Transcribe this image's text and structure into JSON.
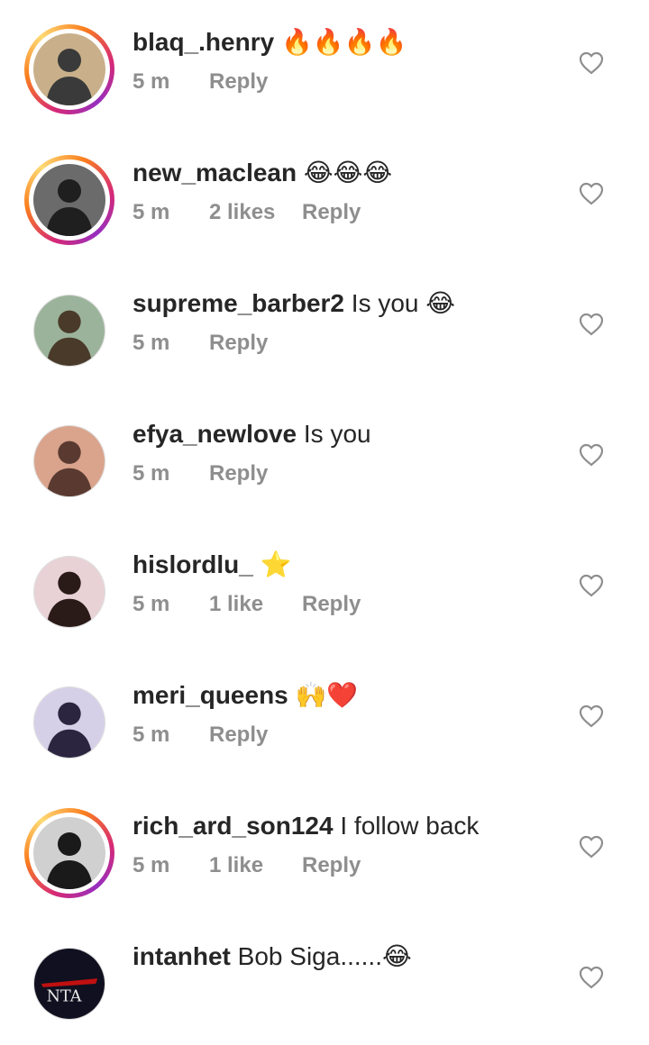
{
  "comments": [
    {
      "username": "blaq_.henry",
      "text": "🔥🔥🔥🔥",
      "time": "5 m",
      "likes": "",
      "reply_label": "Reply",
      "story_ring": true,
      "avatar_icon": "person-avatar",
      "avatar_colors": [
        "#c9b08a",
        "#3a3a3a"
      ]
    },
    {
      "username": "new_maclean",
      "text": "😂😂😂",
      "time": "5 m",
      "likes": "2 likes",
      "reply_label": "Reply",
      "story_ring": true,
      "avatar_icon": "person-avatar",
      "avatar_colors": [
        "#6b6b6b",
        "#1f1f1f"
      ]
    },
    {
      "username": "supreme_barber2",
      "text": "Is you 😂",
      "time": "5 m",
      "likes": "",
      "reply_label": "Reply",
      "story_ring": false,
      "avatar_icon": "person-avatar",
      "avatar_colors": [
        "#9bb39a",
        "#4a3a2a"
      ]
    },
    {
      "username": "efya_newlove",
      "text": "Is you",
      "time": "5 m",
      "likes": "",
      "reply_label": "Reply",
      "story_ring": false,
      "avatar_icon": "person-avatar",
      "avatar_colors": [
        "#d9a38c",
        "#5a3a30"
      ]
    },
    {
      "username": "hislordlu_",
      "text": "⭐",
      "time": "5 m",
      "likes": "1 like",
      "reply_label": "Reply",
      "story_ring": false,
      "avatar_icon": "person-avatar",
      "avatar_colors": [
        "#e8d2d6",
        "#2a1a18"
      ]
    },
    {
      "username": "meri_queens",
      "text": "🙌❤️",
      "time": "5 m",
      "likes": "",
      "reply_label": "Reply",
      "story_ring": false,
      "avatar_icon": "person-avatar",
      "avatar_colors": [
        "#d6cfe8",
        "#2b2540"
      ]
    },
    {
      "username": "rich_ard_son124",
      "text": "I follow back",
      "time": "5 m",
      "likes": "1 like",
      "reply_label": "Reply",
      "story_ring": true,
      "avatar_icon": "person-avatar",
      "avatar_colors": [
        "#d0d0d0",
        "#1a1a1a"
      ]
    },
    {
      "username": "intanhet",
      "text": "Bob Siga......😂",
      "time": "",
      "likes": "",
      "reply_label": "",
      "story_ring": false,
      "avatar_icon": "logo-avatar",
      "avatar_colors": [
        "#101020",
        "#c01010"
      ],
      "avatar_text": "NTA"
    }
  ],
  "colors": {
    "text": "#262626",
    "secondary": "#8e8e8e",
    "heart_outline": "#8e8e8e"
  },
  "icons": {
    "like": "heart-outline-icon"
  }
}
